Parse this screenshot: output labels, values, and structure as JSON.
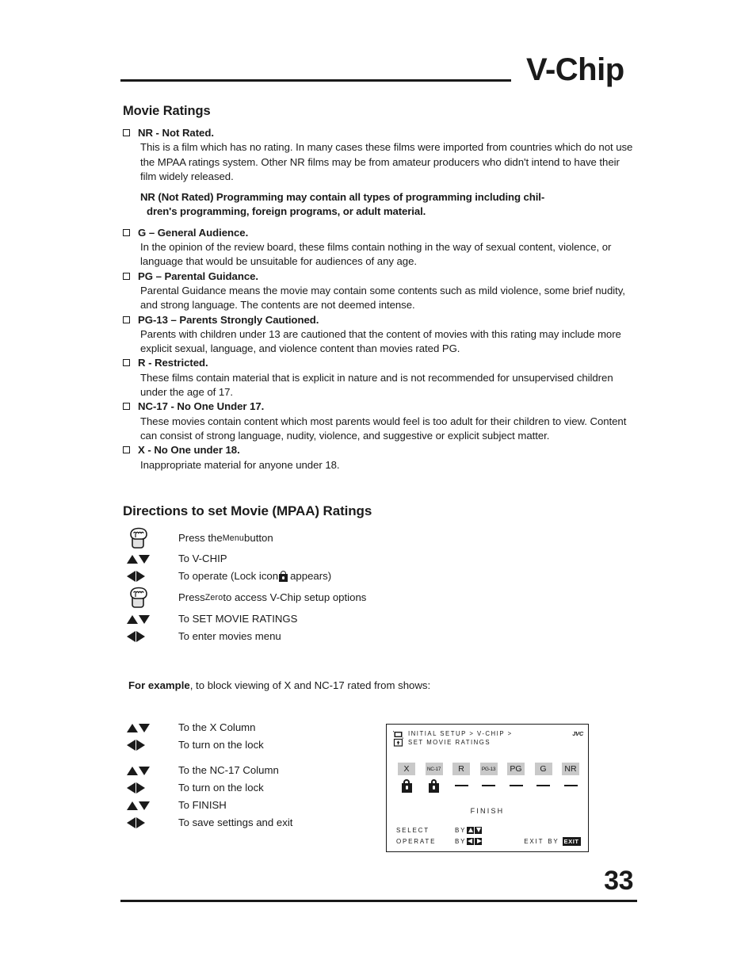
{
  "header": {
    "title": "V-Chip"
  },
  "sections": {
    "movie_ratings_heading": "Movie Ratings",
    "directions_heading": "Directions to set Movie (MPAA) Ratings"
  },
  "ratings": [
    {
      "term": "NR - Not Rated.",
      "desc": "This is a film which has no rating. In many cases these films were imported from countries which do not use the MPAA ratings system. Other NR films may be from amateur producers who didn't intend to have their film widely released.",
      "note_line1": "NR (Not Rated) Programming may contain all types of programming including chil-",
      "note_line2": "dren's programming, foreign programs, or adult material."
    },
    {
      "term": "G – General Audience.",
      "desc": "In the opinion of the review board, these films contain nothing in the way of sexual content, violence, or language that would be unsuitable for audiences of any age."
    },
    {
      "term": "PG – Parental Guidance.",
      "desc": "Parental Guidance means the movie may contain some contents such as mild violence, some brief nudity, and strong language. The contents are not deemed intense."
    },
    {
      "term": "PG-13 – Parents Strongly Cautioned.",
      "desc": "Parents with children under 13 are cautioned that the content of movies with this rating may include more explicit sexual, language, and violence content than movies rated PG."
    },
    {
      "term": "R - Restricted.",
      "desc": "These films contain material that is explicit in nature and is not recommended for unsupervised children under the age of 17."
    },
    {
      "term": "NC-17 - No One Under 17.",
      "desc": "These movies contain content which most parents would feel is too adult for their children to view. Content can consist of strong language, nudity, violence, and suggestive or explicit subject matter."
    },
    {
      "term": "X - No One under 18.",
      "desc": "Inappropriate material for anyone under 18."
    }
  ],
  "steps": [
    {
      "icon": "press-hand-icon",
      "text_pre": "Press the ",
      "text_smallcap": "Menu",
      "text_post": " button"
    },
    {
      "icon": "up-down-arrows-icon",
      "text_pre": "To V-CHIP",
      "text_smallcap": "",
      "text_post": ""
    },
    {
      "icon": "left-right-arrows-icon",
      "text_pre": "To operate (Lock icon",
      "text_smallcap": "",
      "text_post": " appears)",
      "has_lock": true
    },
    {
      "icon": "press-hand-icon",
      "text_pre": "Press ",
      "text_smallcap": "Zero",
      "text_post": " to access V-Chip setup options"
    },
    {
      "icon": "up-down-arrows-icon",
      "text_pre": "To SET MOVIE RATINGS",
      "text_smallcap": "",
      "text_post": ""
    },
    {
      "icon": "left-right-arrows-icon",
      "text_pre": "To enter movies menu",
      "text_smallcap": "",
      "text_post": ""
    }
  ],
  "example": {
    "lead_bold": "For example",
    "lead_rest": ", to block viewing of X and NC-17 rated from shows:",
    "steps": [
      {
        "icon": "up-down-arrows-icon",
        "text": "To the X Column"
      },
      {
        "icon": "left-right-arrows-icon",
        "text": "To turn on the lock"
      },
      {
        "icon": "up-down-arrows-icon",
        "text": "To the NC-17 Column"
      },
      {
        "icon": "left-right-arrows-icon",
        "text": "To turn on the lock"
      },
      {
        "icon": "up-down-arrows-icon",
        "text": "To FINISH"
      },
      {
        "icon": "left-right-arrows-icon",
        "text": "To save settings and exit"
      }
    ]
  },
  "osd": {
    "breadcrumb_line1": "INITIAL SETUP > V-CHIP >",
    "breadcrumb_line2": "SET MOVIE RATINGS",
    "brand": "JVC",
    "columns": [
      {
        "label": "X",
        "tiny": false,
        "state": "locked"
      },
      {
        "label": "NC-17",
        "tiny": true,
        "state": "locked"
      },
      {
        "label": "R",
        "tiny": false,
        "state": "unlocked"
      },
      {
        "label": "PG-13",
        "tiny": true,
        "state": "unlocked"
      },
      {
        "label": "PG",
        "tiny": false,
        "state": "unlocked"
      },
      {
        "label": "G",
        "tiny": false,
        "state": "unlocked"
      },
      {
        "label": "NR",
        "tiny": false,
        "state": "unlocked"
      }
    ],
    "finish": "FINISH",
    "footer": {
      "select_label": "SELECT",
      "select_by": "BY",
      "operate_label": "OPERATE",
      "operate_by": "BY",
      "exit_label": "EXIT",
      "exit_by": "BY",
      "exit_badge": "EXIT"
    },
    "chip_bg": "#c9c9c9"
  },
  "footer": {
    "page_number": "33"
  }
}
